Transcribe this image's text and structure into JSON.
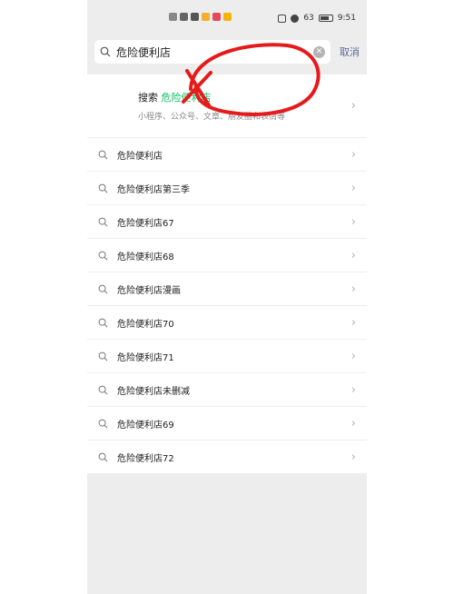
{
  "status_bar": {
    "battery": "63",
    "time": "9:51"
  },
  "search": {
    "query": "危险便利店",
    "cancel_label": "取消"
  },
  "search_all": {
    "prefix": "搜索 ",
    "keyword": "危险便利店",
    "subtitle": "小程序、公众号、文章、朋友圈和表情等"
  },
  "suggestions": [
    {
      "label": "危险便利店"
    },
    {
      "label": "危险便利店第三季"
    },
    {
      "label": "危险便利店67"
    },
    {
      "label": "危险便利店68"
    },
    {
      "label": "危险便利店漫画"
    },
    {
      "label": "危险便利店70"
    },
    {
      "label": "危险便利店71"
    },
    {
      "label": "危险便利店未删减"
    },
    {
      "label": "危险便利店69"
    },
    {
      "label": "危险便利店72"
    }
  ],
  "colors": {
    "accent": "#07c160",
    "link": "#576b95",
    "annotation": "#e41b1b"
  }
}
